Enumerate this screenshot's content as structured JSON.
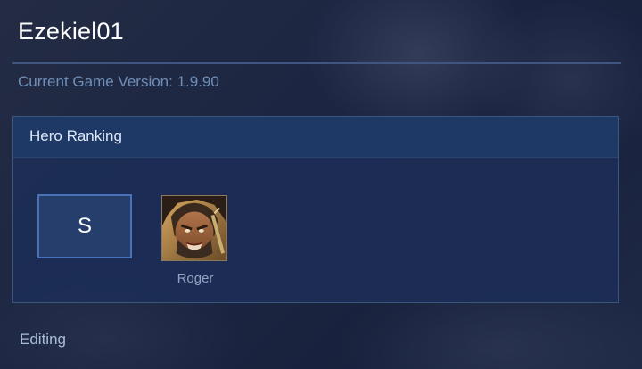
{
  "player": {
    "name": "Ezekiel01"
  },
  "game_version": {
    "text": "Current Game Version: 1.9.90"
  },
  "hero_ranking": {
    "header": "Hero Ranking",
    "tier": "S",
    "heroes": [
      {
        "name": "Roger",
        "portrait_icon": "roger-portrait-icon"
      }
    ]
  },
  "footer": {
    "editing_label": "Editing"
  },
  "colors": {
    "background": "#1a2440",
    "panel": "#1c2e56",
    "panel_header": "#203a68",
    "tier_border": "#4a72b8",
    "version_text": "#6f8fb8"
  }
}
